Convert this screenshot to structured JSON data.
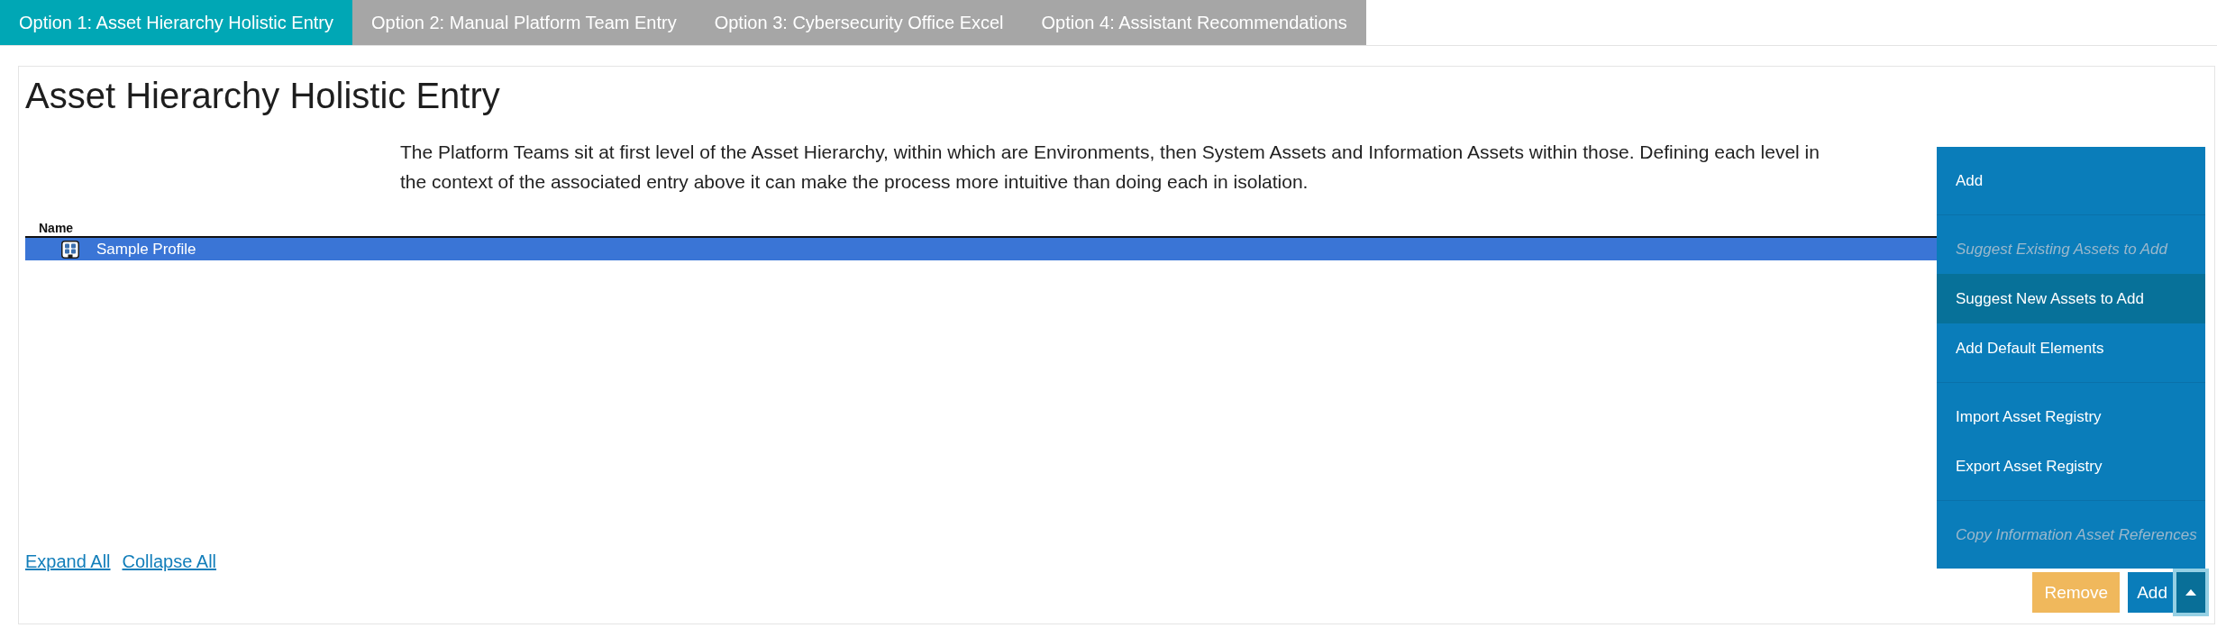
{
  "tabs": [
    {
      "label": "Option 1: Asset Hierarchy Holistic Entry",
      "selected": true
    },
    {
      "label": "Option 2: Manual Platform Team Entry",
      "selected": false
    },
    {
      "label": "Option 3: Cybersecurity Office Excel",
      "selected": false
    },
    {
      "label": "Option 4: Assistant Recommendations",
      "selected": false
    }
  ],
  "panel": {
    "title": "Asset Hierarchy Holistic Entry",
    "description": "The Platform Teams sit at first level of the Asset Hierarchy, within which are Environments, then System Assets and Information Assets within those. Defining each level in the context of the associated entry above it can make the process more intuitive than doing each in isolation.",
    "tree": {
      "columns": [
        "Name"
      ],
      "rows": [
        {
          "name": "Sample Profile",
          "selected": true
        }
      ]
    },
    "links": [
      "Expand All",
      "Collapse All"
    ],
    "actions": [
      {
        "kind": "warning",
        "label": "Remove"
      },
      {
        "kind": "split",
        "label": "Add",
        "expanded": true,
        "menu": [
          {
            "items": [
              {
                "label": "Add",
                "disabled": false,
                "selected": false
              }
            ]
          },
          {
            "items": [
              {
                "label": "Suggest Existing Assets to Add",
                "disabled": true,
                "selected": false
              },
              {
                "label": "Suggest New Assets to Add",
                "disabled": false,
                "selected": true
              },
              {
                "label": "Add Default Elements",
                "disabled": false,
                "selected": false
              }
            ]
          },
          {
            "items": [
              {
                "label": "Import Asset Registry",
                "disabled": false,
                "selected": false
              },
              {
                "label": "Export Asset Registry",
                "disabled": false,
                "selected": false
              }
            ]
          },
          {
            "items": [
              {
                "label": "Copy Information Asset References",
                "disabled": true,
                "selected": false
              }
            ]
          }
        ]
      }
    ]
  }
}
